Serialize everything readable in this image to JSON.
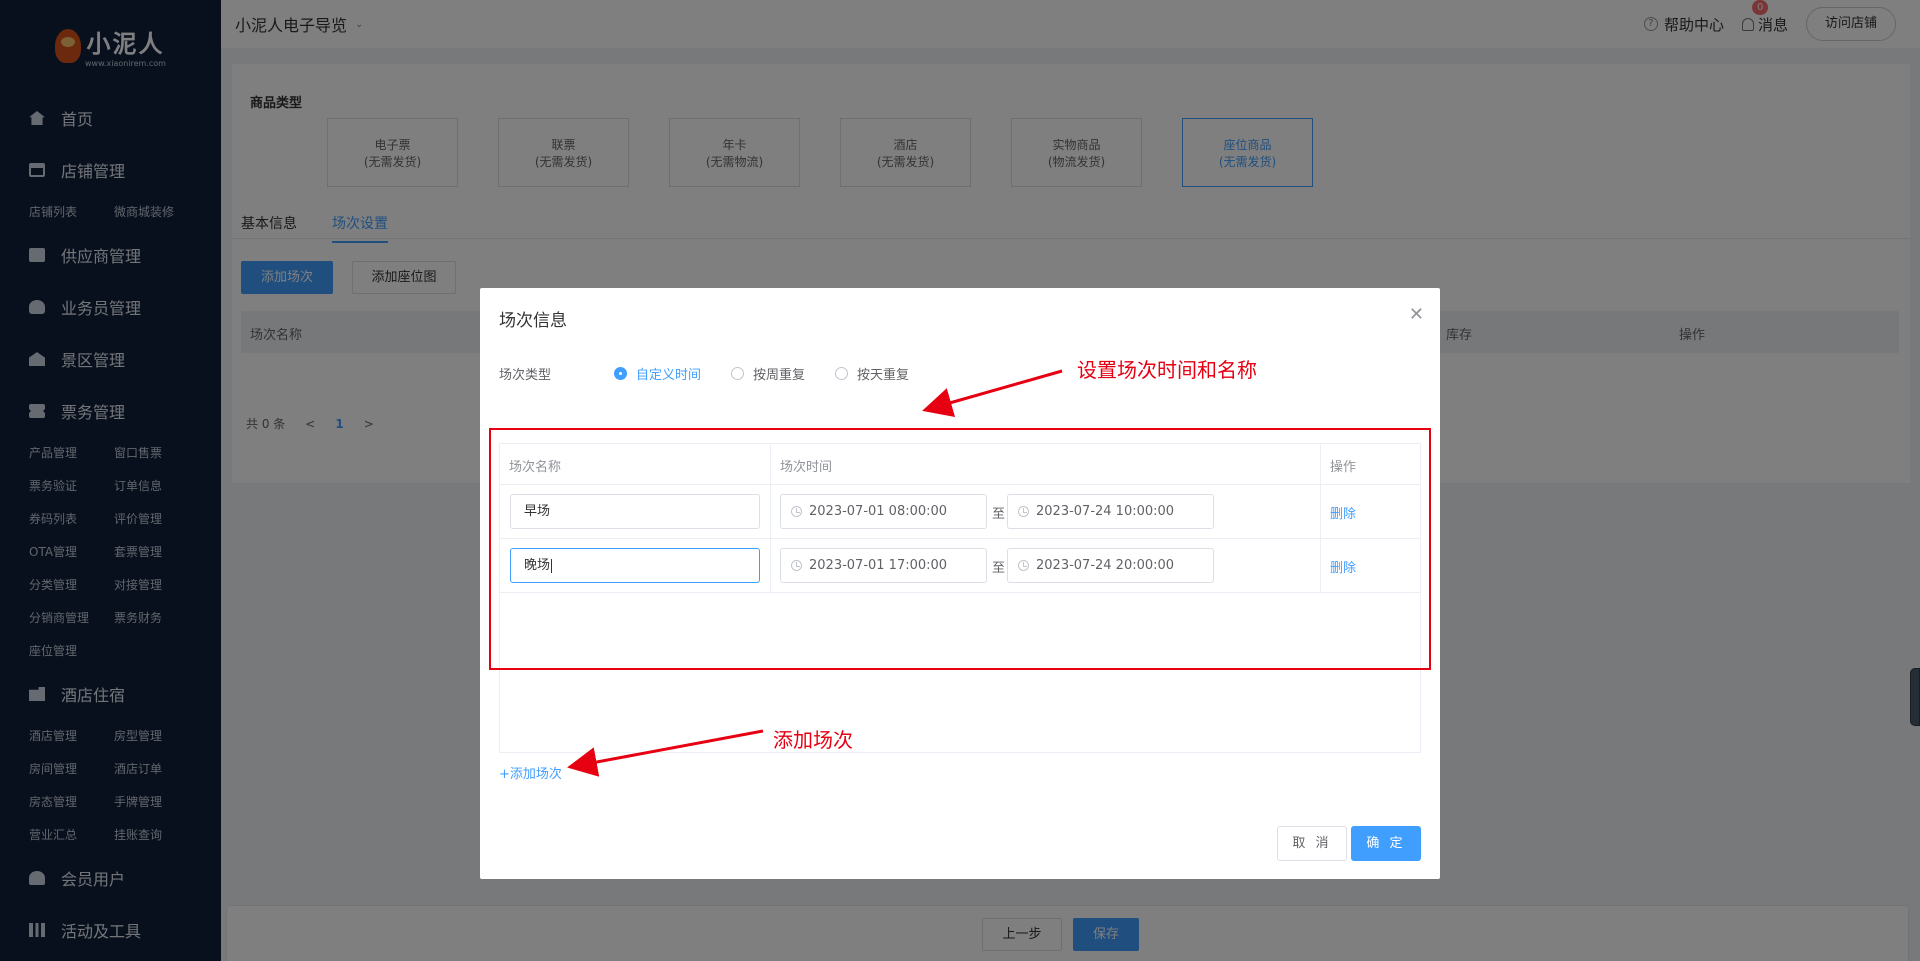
{
  "sidebar": {
    "logo": {
      "name": "小泥人",
      "url": "www.xiaonirem.com"
    },
    "groups": [
      {
        "label": "首页",
        "icon": "home-icon",
        "subs": []
      },
      {
        "label": "店铺管理",
        "icon": "store-icon",
        "subs": [
          "店铺列表",
          "微商城装修"
        ]
      },
      {
        "label": "供应商管理",
        "icon": "truck-icon",
        "subs": []
      },
      {
        "label": "业务员管理",
        "icon": "user-icon",
        "subs": []
      },
      {
        "label": "景区管理",
        "icon": "scenic-icon",
        "subs": []
      },
      {
        "label": "票务管理",
        "icon": "ticket-icon",
        "subs": [
          "产品管理",
          "窗口售票",
          "票务验证",
          "订单信息",
          "券码列表",
          "评价管理",
          "OTA管理",
          "套票管理",
          "分类管理",
          "对接管理",
          "分销商管理",
          "票务财务",
          "座位管理"
        ]
      },
      {
        "label": "酒店住宿",
        "icon": "hotel-icon",
        "subs": [
          "酒店管理",
          "房型管理",
          "房间管理",
          "酒店订单",
          "房态管理",
          "手牌管理",
          "营业汇总",
          "挂账查询"
        ]
      },
      {
        "label": "会员用户",
        "icon": "members-icon",
        "subs": []
      },
      {
        "label": "活动及工具",
        "icon": "tools-icon",
        "subs": []
      }
    ]
  },
  "header": {
    "title": "小泥人电子导览",
    "help": "帮助中心",
    "messages": "消息",
    "message_count": "0",
    "visit_store": "访问店铺"
  },
  "page": {
    "product_type_label": "商品类型",
    "product_types": [
      {
        "name": "电子票",
        "note": "(无需发货)"
      },
      {
        "name": "联票",
        "note": "(无需发货)"
      },
      {
        "name": "年卡",
        "note": "(无需物流)"
      },
      {
        "name": "酒店",
        "note": "(无需发货)"
      },
      {
        "name": "实物商品",
        "note": "(物流发货)"
      },
      {
        "name": "座位商品",
        "note": "(无需发货)"
      }
    ],
    "tabs": [
      "基本信息",
      "场次设置"
    ],
    "add_session_btn": "添加场次",
    "add_seatmap_btn": "添加座位图",
    "table_cols": [
      "场次名称",
      "库存",
      "操作"
    ],
    "pager": {
      "total": "共 0 条",
      "prev": "<",
      "page": "1",
      "next": ">"
    },
    "prev_step": "上一步",
    "save": "保存"
  },
  "dialog": {
    "title": "场次信息",
    "type_label": "场次类型",
    "radios": [
      "自定义时间",
      "按周重复",
      "按天重复"
    ],
    "columns": [
      "场次名称",
      "场次时间",
      "操作"
    ],
    "rows": [
      {
        "name": "早场",
        "start": "2023-07-01 08:00:00",
        "end": "2023-07-24 10:00:00"
      },
      {
        "name": "晚场",
        "start": "2023-07-01 17:00:00",
        "end": "2023-07-24 20:00:00"
      }
    ],
    "to": "至",
    "delete": "删除",
    "add_session": "+添加场次",
    "cancel": "取 消",
    "confirm": "确 定"
  },
  "annotations": {
    "top": "设置场次时间和名称",
    "bottom": "添加场次",
    "color": "#e60012"
  }
}
